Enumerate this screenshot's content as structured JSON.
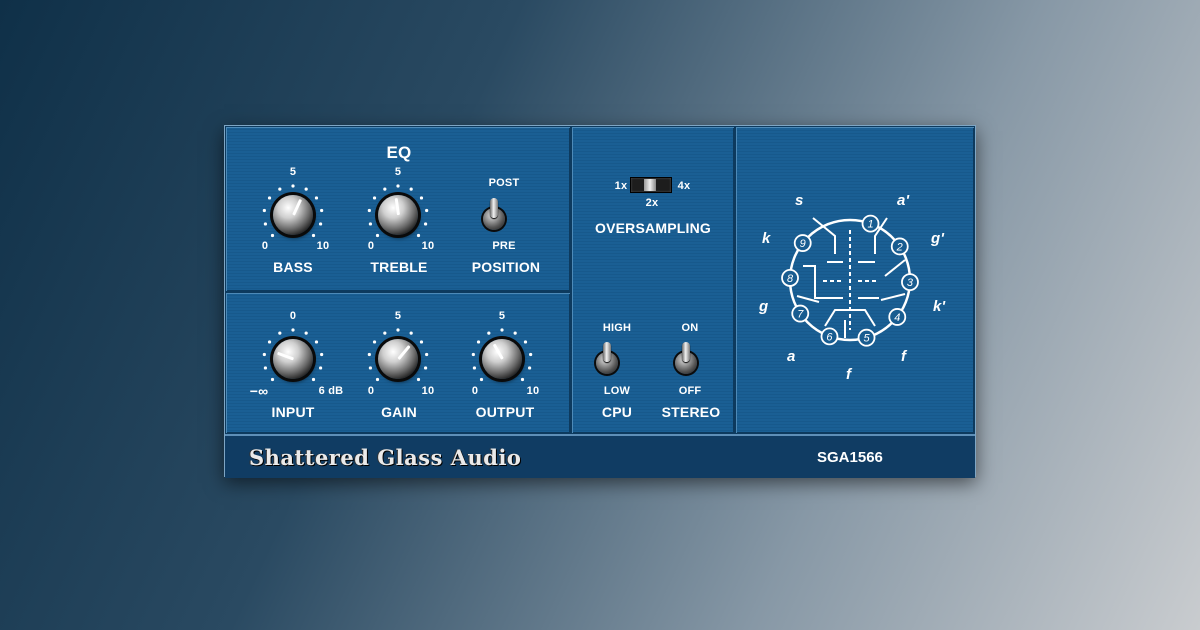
{
  "eq": {
    "title": "EQ",
    "bass": {
      "label": "BASS",
      "min": "0",
      "mid": "5",
      "max": "10",
      "value": 6
    },
    "treble": {
      "label": "TREBLE",
      "min": "0",
      "mid": "5",
      "max": "10",
      "value": 5.5
    },
    "position": {
      "label": "POSITION",
      "top": "POST",
      "bottom": "PRE",
      "state": "POST"
    }
  },
  "gain_section": {
    "input": {
      "label": "INPUT",
      "min": "−∞",
      "mid": "0",
      "max": "6 dB"
    },
    "gain": {
      "label": "GAIN",
      "min": "0",
      "mid": "5",
      "max": "10",
      "value": 6.5
    },
    "output": {
      "label": "OUTPUT",
      "min": "0",
      "mid": "5",
      "max": "10",
      "value": 4
    }
  },
  "oversampling": {
    "label": "OVERSAMPLING",
    "opt_1x": "1x",
    "opt_2x": "2x",
    "opt_4x": "4x",
    "selected": "2x"
  },
  "cpu": {
    "label": "CPU",
    "top": "HIGH",
    "bottom": "LOW",
    "state": "HIGH"
  },
  "stereo": {
    "label": "STEREO",
    "top": "ON",
    "bottom": "OFF",
    "state": "ON"
  },
  "tube_diagram": {
    "pins": [
      "1",
      "2",
      "3",
      "4",
      "5",
      "6",
      "7",
      "8",
      "9"
    ],
    "pin_labels": {
      "s": "s",
      "a1": "a'",
      "g1": "g'",
      "k1": "k'",
      "k": "k",
      "g": "g",
      "a": "a",
      "f1": "f",
      "f2": "f"
    }
  },
  "footer": {
    "brand": "Shattered Glass Audio",
    "model": "SGA1566"
  },
  "colors": {
    "panel": "#185c90",
    "footer": "#103c63",
    "text": "#ffffff"
  }
}
